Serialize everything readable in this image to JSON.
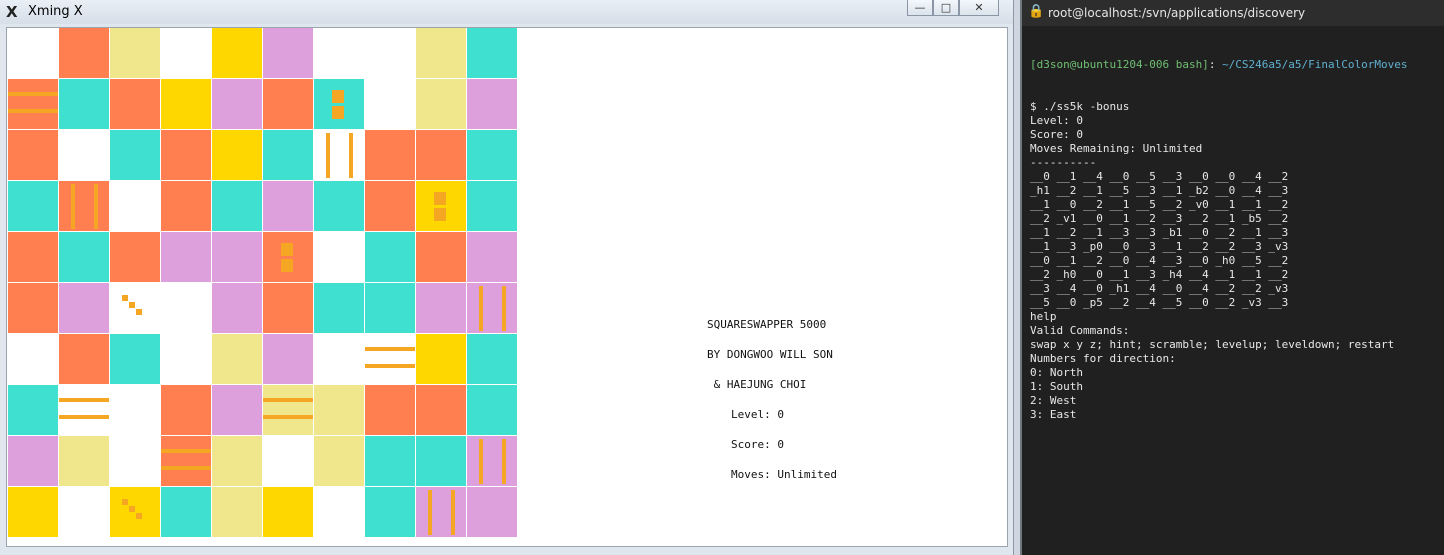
{
  "xming": {
    "title": "Xming X",
    "icon": "x-logo-icon",
    "buttons": {
      "minimize": "—",
      "maximize": "□",
      "close": "✕"
    }
  },
  "colors": {
    "O": "#ff7f50",
    "T": "#40e0d0",
    "Y": "#ffd700",
    "L": "#f0e68c",
    "P": "#dda0dd",
    "W": "#ffffff",
    "mark": "#f5a623"
  },
  "board": {
    "rows": [
      [
        "W",
        "O",
        "L",
        "W",
        "Y",
        "P",
        "W",
        "W",
        "L",
        "T"
      ],
      [
        "O",
        "T",
        "O",
        "Y",
        "P",
        "O",
        "T",
        "W",
        "L",
        "P"
      ],
      [
        "O",
        "W",
        "T",
        "O",
        "Y",
        "T",
        "W",
        "O",
        "O",
        "T"
      ],
      [
        "T",
        "O",
        "W",
        "O",
        "T",
        "P",
        "T",
        "O",
        "Y",
        "T"
      ],
      [
        "O",
        "T",
        "O",
        "P",
        "P",
        "O",
        "W",
        "T",
        "O",
        "P"
      ],
      [
        "O",
        "P",
        "W",
        "W",
        "P",
        "O",
        "T",
        "T",
        "P",
        "P"
      ],
      [
        "W",
        "O",
        "T",
        "W",
        "L",
        "P",
        "W",
        "W",
        "Y",
        "T"
      ],
      [
        "T",
        "W",
        "W",
        "O",
        "P",
        "L",
        "L",
        "O",
        "O",
        "T"
      ],
      [
        "P",
        "L",
        "W",
        "O",
        "L",
        "W",
        "L",
        "T",
        "T",
        "P"
      ],
      [
        "Y",
        "W",
        "Y",
        "T",
        "L",
        "Y",
        "W",
        "T",
        "P",
        "P"
      ]
    ],
    "marks": [
      {
        "r": 1,
        "c": 0,
        "type": "h"
      },
      {
        "r": 1,
        "c": 6,
        "type": "b"
      },
      {
        "r": 2,
        "c": 6,
        "type": "v"
      },
      {
        "r": 3,
        "c": 1,
        "type": "v"
      },
      {
        "r": 3,
        "c": 8,
        "type": "b"
      },
      {
        "r": 4,
        "c": 5,
        "type": "b"
      },
      {
        "r": 5,
        "c": 2,
        "type": "p"
      },
      {
        "r": 5,
        "c": 9,
        "type": "v"
      },
      {
        "r": 6,
        "c": 7,
        "type": "h"
      },
      {
        "r": 7,
        "c": 1,
        "type": "h"
      },
      {
        "r": 7,
        "c": 5,
        "type": "h"
      },
      {
        "r": 8,
        "c": 3,
        "type": "h"
      },
      {
        "r": 8,
        "c": 9,
        "type": "v"
      },
      {
        "r": 9,
        "c": 2,
        "type": "p"
      },
      {
        "r": 9,
        "c": 8,
        "type": "v"
      }
    ]
  },
  "info": {
    "title": "SQUARESWAPPER 5000",
    "by": "BY DONGWOO WILL SON",
    "and": " & HAEJUNG CHOI",
    "level": "Level: 0",
    "score": "Score: 0",
    "moves": "Moves: Unlimited"
  },
  "terminal": {
    "title": "root@localhost:/svn/applications/discovery",
    "prompt_user": "[d3son@ubuntu1204-006 bash]",
    "prompt_sep": ": ",
    "prompt_path": "~/CS246a5/a5/FinalColorMoves",
    "lines": [
      "$ ./ss5k -bonus",
      "Level: 0",
      "Score: 0",
      "Moves Remaining: Unlimited",
      "----------",
      "__0 __1 __4 __0 __5 __3 __0 __0 __4 __2",
      "_h1 __2 __1 __5 __3 __1 _b2 __0 __4 __3",
      "__1 __0 __2 __1 __5 __2 _v0 __1 __1 __2",
      "__2 _v1 __0 __1 __2 __3 __2 __1 _b5 __2",
      "__1 __2 __1 __3 __3 _b1 __0 __2 __1 __3",
      "__1 __3 _p0 __0 __3 __1 __2 __2 __3 _v3",
      "__0 __1 __2 __0 __4 __3 __0 _h0 __5 __2",
      "__2 _h0 __0 __1 __3 _h4 __4 __1 __1 __2",
      "__3 __4 __0 _h1 __4 __0 __4 __2 __2 _v3",
      "__5 __0 _p5 __2 __4 __5 __0 __2 _v3 __3",
      "help",
      "Valid Commands:",
      "swap x y z; hint; scramble; levelup; leveldown; restart",
      "Numbers for direction:",
      "0: North",
      "1: South",
      "2: West",
      "3: East"
    ]
  }
}
